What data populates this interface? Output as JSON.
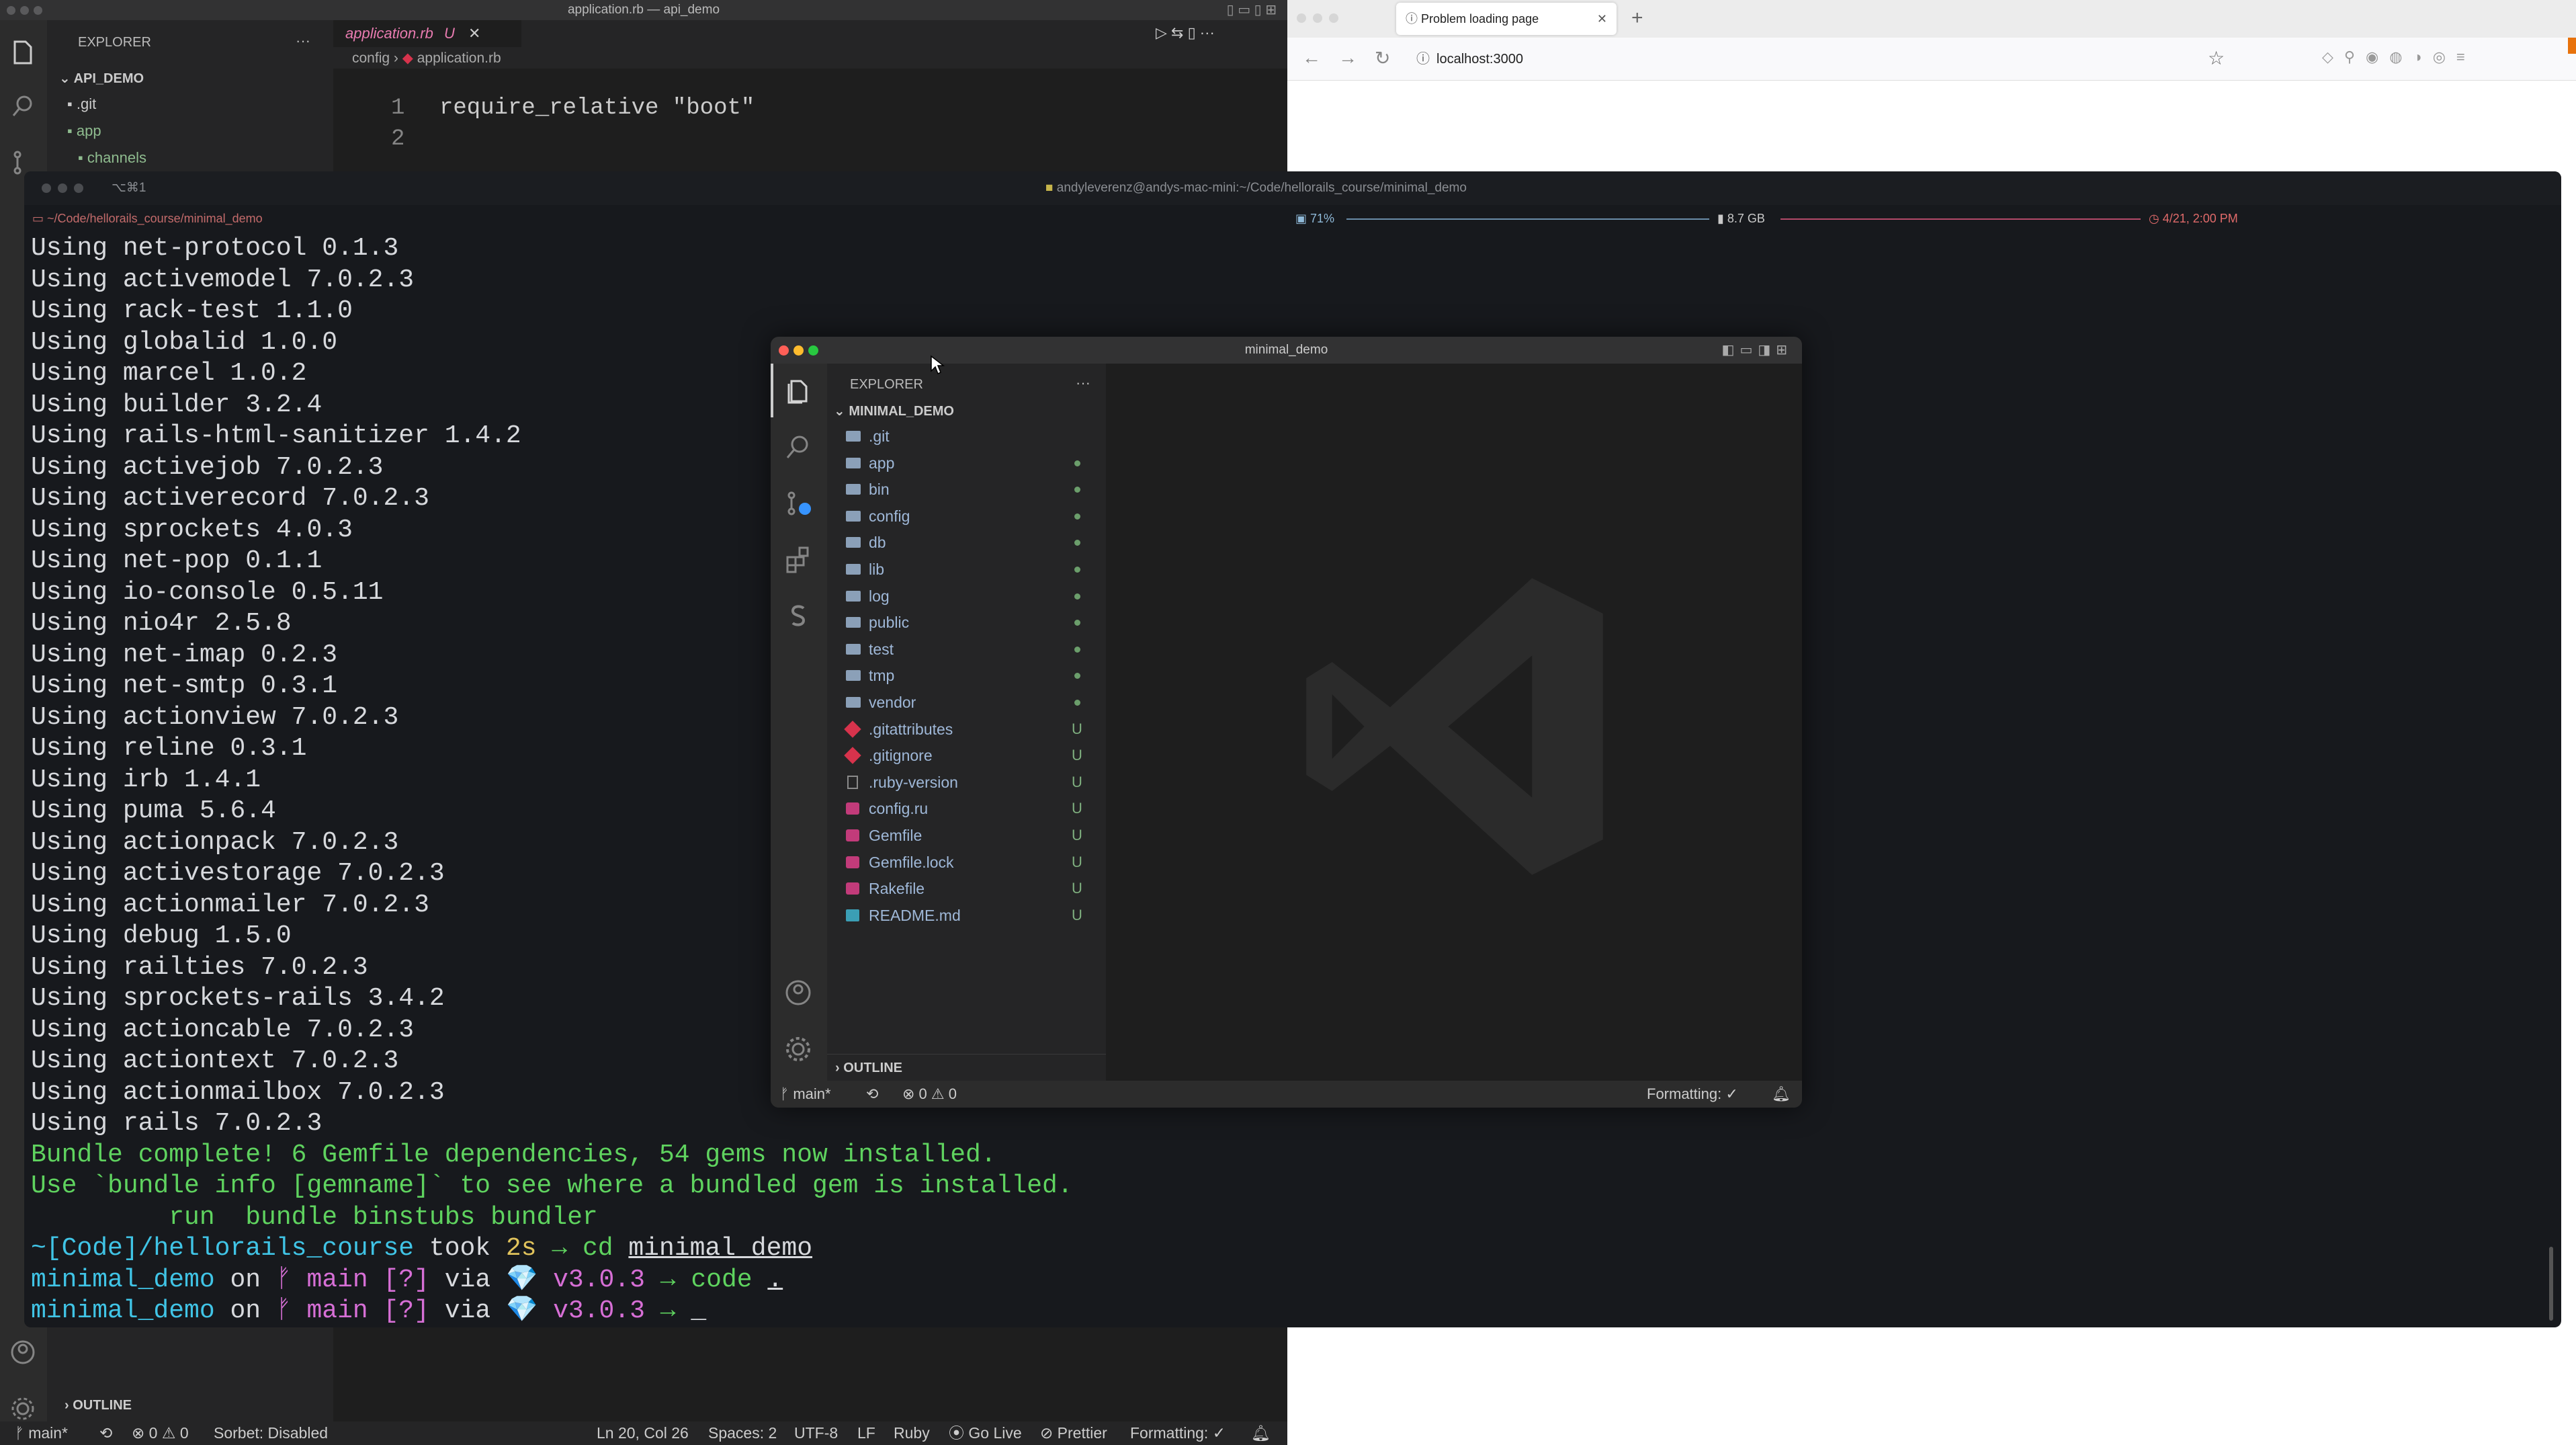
{
  "vscode_back": {
    "window_title": "application.rb — api_demo",
    "explorer_label": "EXPLORER",
    "explorer_more": "···",
    "project": "API_DEMO",
    "tree": [
      {
        "name": ".git"
      },
      {
        "name": "app"
      },
      {
        "name": "channels"
      }
    ],
    "tab_label": "application.rb",
    "tab_badge": "U",
    "breadcrumb": [
      "config",
      "application.rb"
    ],
    "code": [
      {
        "num": "1",
        "text": "require_relative \"boot\""
      },
      {
        "num": "2",
        "text": ""
      }
    ],
    "outline_label": "OUTLINE",
    "status": {
      "branch": "main*",
      "errors": "0",
      "warnings": "0",
      "sorbet": "Sorbet: Disabled",
      "position": "Ln 20, Col 26",
      "spaces": "Spaces: 2",
      "encoding": "UTF-8",
      "eol": "LF",
      "language": "Ruby",
      "golive": "Go Live",
      "prettier": "Prettier",
      "formatting": "Formatting: ✓"
    }
  },
  "browser": {
    "tab_title": "Problem loading page",
    "url": "localhost:3000",
    "colors": {
      "accent": "#e8720c"
    }
  },
  "terminal": {
    "tab_label": "⌥⌘1",
    "path": "~/Code/hellorails_course/minimal_demo",
    "title": "andyleverenz@andys-mac-mini:~/Code/hellorails_course/minimal_demo",
    "cpu": "71%",
    "mem": "8.7 GB",
    "datetime": "4/21, 2:00 PM",
    "gems": [
      "Using net-protocol 0.1.3",
      "Using activemodel 7.0.2.3",
      "Using rack-test 1.1.0",
      "Using globalid 1.0.0",
      "Using marcel 1.0.2",
      "Using builder 3.2.4",
      "Using rails-html-sanitizer 1.4.2",
      "Using activejob 7.0.2.3",
      "Using activerecord 7.0.2.3",
      "Using sprockets 4.0.3",
      "Using net-pop 0.1.1",
      "Using io-console 0.5.11",
      "Using nio4r 2.5.8",
      "Using net-imap 0.2.3",
      "Using net-smtp 0.3.1",
      "Using actionview 7.0.2.3",
      "Using reline 0.3.1",
      "Using irb 1.4.1",
      "Using puma 5.6.4",
      "Using actionpack 7.0.2.3",
      "Using activestorage 7.0.2.3",
      "Using actionmailer 7.0.2.3",
      "Using debug 1.5.0",
      "Using railties 7.0.2.3",
      "Using sprockets-rails 3.4.2",
      "Using actioncable 7.0.2.3",
      "Using actiontext 7.0.2.3",
      "Using actionmailbox 7.0.2.3",
      "Using rails 7.0.2.3"
    ],
    "bundle_complete": "Bundle complete! 6 Gemfile dependencies, 54 gems now installed.",
    "bundle_info": "Use `bundle info [gemname]` to see where a bundled gem is installed.",
    "binstubs": "         run  bundle binstubs bundler",
    "prompt1": {
      "path": "~[Code]/hellorails_course",
      "took": " took ",
      "dur": "2s",
      "arrow": " → ",
      "cmd": "cd ",
      "arg": "minimal_demo"
    },
    "prompt2": {
      "dir": "minimal_demo",
      "on": " on ",
      "branch": "ᚠ main [?]",
      "via": " via ",
      "gem": "💎",
      "ver": " v3.0.3",
      "arrow": " → ",
      "cmd": "code ",
      "arg": "."
    },
    "prompt3": {
      "dir": "minimal_demo",
      "on": " on ",
      "branch": "ᚠ main [?]",
      "via": " via ",
      "gem": "💎",
      "ver": " v3.0.3",
      "arrow": " → ",
      "cursor": "_"
    }
  },
  "vscode_front": {
    "window_title": "minimal_demo",
    "explorer_label": "EXPLORER",
    "explorer_more": "···",
    "project": "MINIMAL_DEMO",
    "items": [
      {
        "name": ".git",
        "kind": "folder",
        "mark": ""
      },
      {
        "name": "app",
        "kind": "folder",
        "mark": "dot"
      },
      {
        "name": "bin",
        "kind": "folder",
        "mark": "dot"
      },
      {
        "name": "config",
        "kind": "folder",
        "mark": "dot"
      },
      {
        "name": "db",
        "kind": "folder",
        "mark": "dot"
      },
      {
        "name": "lib",
        "kind": "folder",
        "mark": "dot"
      },
      {
        "name": "log",
        "kind": "folder",
        "mark": "dot"
      },
      {
        "name": "public",
        "kind": "folder",
        "mark": "dot"
      },
      {
        "name": "test",
        "kind": "folder",
        "mark": "dot"
      },
      {
        "name": "tmp",
        "kind": "folder",
        "mark": "dot"
      },
      {
        "name": "vendor",
        "kind": "folder",
        "mark": "dot"
      },
      {
        "name": ".gitattributes",
        "kind": "git",
        "mark": "U"
      },
      {
        "name": ".gitignore",
        "kind": "git",
        "mark": "U"
      },
      {
        "name": ".ruby-version",
        "kind": "file",
        "mark": "U"
      },
      {
        "name": "config.ru",
        "kind": "ruby",
        "mark": "U"
      },
      {
        "name": "Gemfile",
        "kind": "ruby",
        "mark": "U"
      },
      {
        "name": "Gemfile.lock",
        "kind": "ruby",
        "mark": "U"
      },
      {
        "name": "Rakefile",
        "kind": "ruby",
        "mark": "U"
      },
      {
        "name": "README.md",
        "kind": "md",
        "mark": "U"
      }
    ],
    "outline_label": "OUTLINE",
    "status": {
      "branch": "main*",
      "errors": "0",
      "warnings": "0",
      "formatting": "Formatting: ✓"
    }
  }
}
